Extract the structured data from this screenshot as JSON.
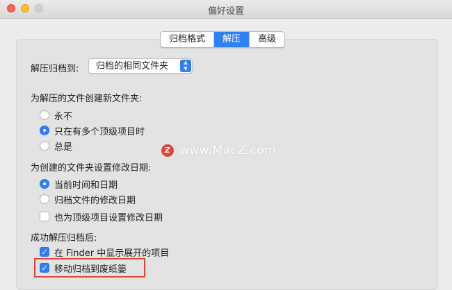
{
  "window": {
    "title": "偏好设置"
  },
  "tabs": [
    {
      "label": "归档格式",
      "active": false
    },
    {
      "label": "解压",
      "active": true
    },
    {
      "label": "高级",
      "active": false
    }
  ],
  "unarchive_to": {
    "label": "解压归档到:",
    "value": "归档的相同文件夹"
  },
  "new_folder": {
    "label": "为解压的文件创建新文件夹:",
    "options": [
      {
        "label": "永不",
        "selected": false
      },
      {
        "label": "只在有多个顶级项目时",
        "selected": true
      },
      {
        "label": "总是",
        "selected": false
      }
    ]
  },
  "modify_date": {
    "label": "为创建的文件夹设置修改日期:",
    "options": [
      {
        "label": "当前时间和日期",
        "selected": true
      },
      {
        "label": "归档文件的修改日期",
        "selected": false
      }
    ],
    "top_level_checkbox": {
      "label": "也为顶级项目设置修改日期",
      "checked": false
    }
  },
  "after_success": {
    "label": "成功解压归档后:",
    "show_in_finder": {
      "label": "在 Finder 中显示展开的项目",
      "checked": true
    },
    "move_to_trash": {
      "label": "移动归档到废纸篓",
      "checked": true
    }
  },
  "watermark": {
    "logo": "Z",
    "text": "www.MacZ.com"
  },
  "colors": {
    "accent": "#2f7ff6",
    "highlight_border": "#e0443c"
  }
}
